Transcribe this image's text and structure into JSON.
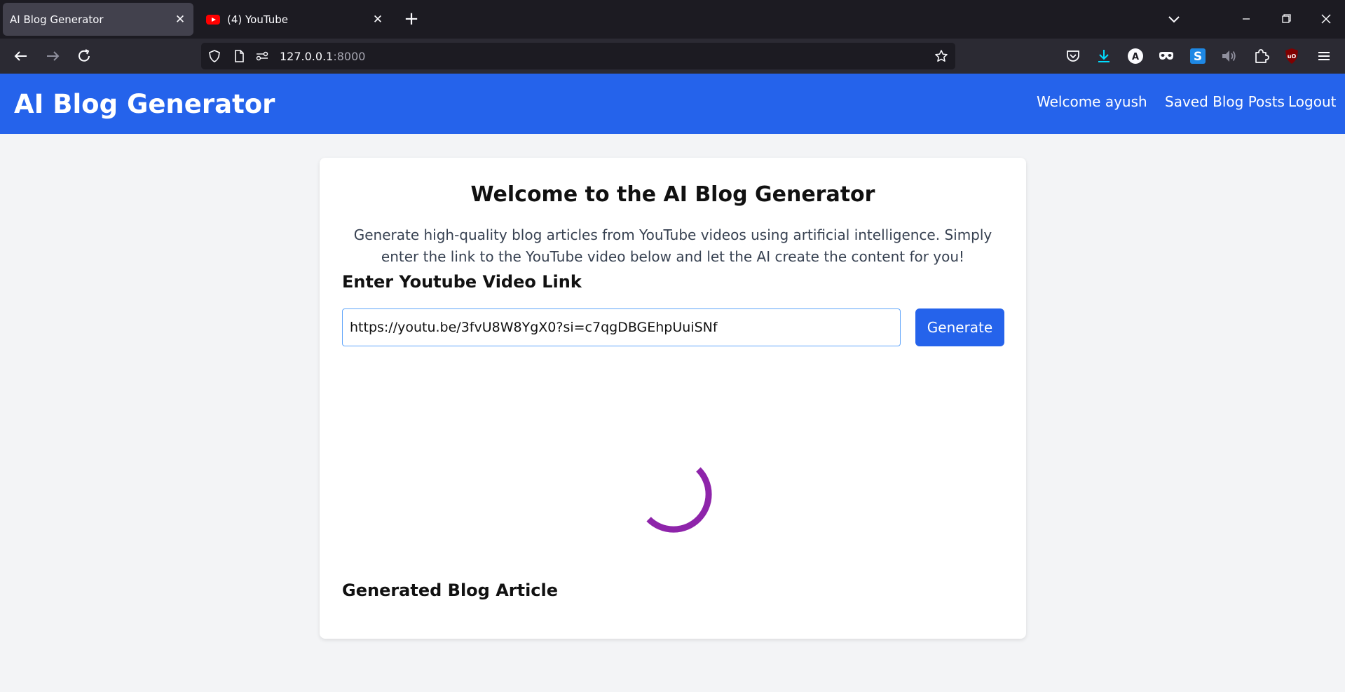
{
  "browser": {
    "tabs": [
      {
        "title": "AI Blog Generator",
        "active": true
      },
      {
        "title": "(4) YouTube",
        "active": false
      }
    ],
    "url": {
      "host": "127.0.0.1",
      "port": ":8000"
    }
  },
  "header": {
    "brand": "AI Blog Generator",
    "welcome": "Welcome ayush",
    "saved_posts": "Saved Blog Posts",
    "logout": "Logout",
    "color": "#2563eb"
  },
  "main": {
    "title": "Welcome to the AI Blog Generator",
    "description": "Generate high-quality blog articles from YouTube videos using artificial intelligence. Simply enter the link to the YouTube video below and let the AI create the content for you!",
    "input_label": "Enter Youtube Video Link",
    "input_value": "https://youtu.be/3fvU8W8YgX0?si=c7qgDBGEhpUuiSNf",
    "generate_label": "Generate",
    "loading": true,
    "spinner_color": "#8e24aa",
    "article_label": "Generated Blog Article"
  }
}
